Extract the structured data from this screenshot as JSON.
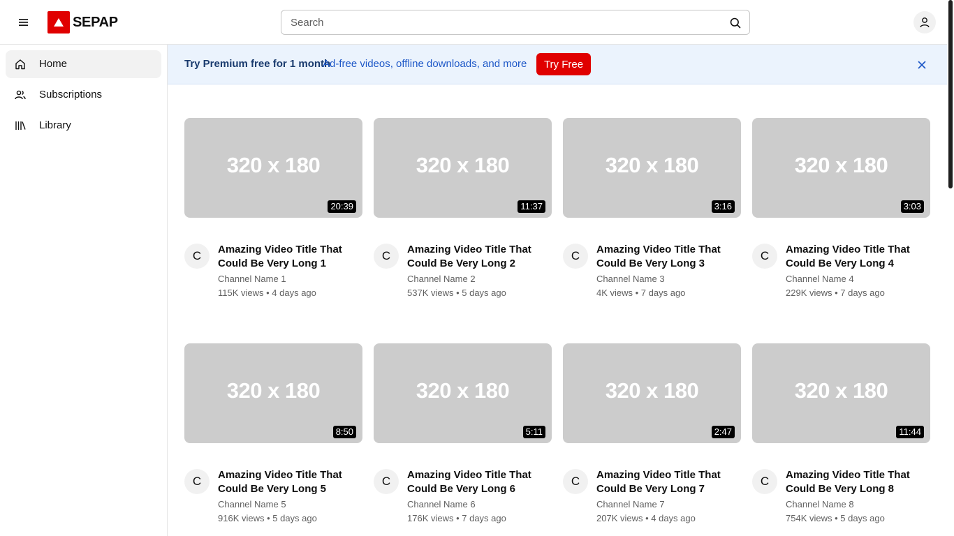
{
  "header": {
    "brand": "SEPAP",
    "search_placeholder": "Search"
  },
  "sidebar": {
    "items": [
      {
        "label": "Home",
        "icon": "home-icon",
        "active": true
      },
      {
        "label": "Subscriptions",
        "icon": "subscriptions-icon",
        "active": false
      },
      {
        "label": "Library",
        "icon": "library-icon",
        "active": false
      }
    ]
  },
  "banner": {
    "title": "Try Premium free for 1 month",
    "subtitle": "Ad-free videos, offline downloads, and more",
    "button": "Try Free"
  },
  "colors": {
    "brand_red": "#e00000",
    "banner_bg": "#ebf3fd",
    "thumb_placeholder": "#cccccc"
  },
  "videos": [
    {
      "thumb": "320 x 180",
      "duration": "20:39",
      "avatar": "C",
      "title": "Amazing Video Title That Could Be Very Long 1",
      "channel": "Channel Name 1",
      "meta": "115K views • 4 days ago"
    },
    {
      "thumb": "320 x 180",
      "duration": "11:37",
      "avatar": "C",
      "title": "Amazing Video Title That Could Be Very Long 2",
      "channel": "Channel Name 2",
      "meta": "537K views • 5 days ago"
    },
    {
      "thumb": "320 x 180",
      "duration": "3:16",
      "avatar": "C",
      "title": "Amazing Video Title That Could Be Very Long 3",
      "channel": "Channel Name 3",
      "meta": "4K views • 7 days ago"
    },
    {
      "thumb": "320 x 180",
      "duration": "3:03",
      "avatar": "C",
      "title": "Amazing Video Title That Could Be Very Long 4",
      "channel": "Channel Name 4",
      "meta": "229K views • 7 days ago"
    },
    {
      "thumb": "320 x 180",
      "duration": "8:50",
      "avatar": "C",
      "title": "Amazing Video Title That Could Be Very Long 5",
      "channel": "Channel Name 5",
      "meta": "916K views • 5 days ago"
    },
    {
      "thumb": "320 x 180",
      "duration": "5:11",
      "avatar": "C",
      "title": "Amazing Video Title That Could Be Very Long 6",
      "channel": "Channel Name 6",
      "meta": "176K views • 7 days ago"
    },
    {
      "thumb": "320 x 180",
      "duration": "2:47",
      "avatar": "C",
      "title": "Amazing Video Title That Could Be Very Long 7",
      "channel": "Channel Name 7",
      "meta": "207K views • 4 days ago"
    },
    {
      "thumb": "320 x 180",
      "duration": "11:44",
      "avatar": "C",
      "title": "Amazing Video Title That Could Be Very Long 8",
      "channel": "Channel Name 8",
      "meta": "754K views • 5 days ago"
    }
  ]
}
